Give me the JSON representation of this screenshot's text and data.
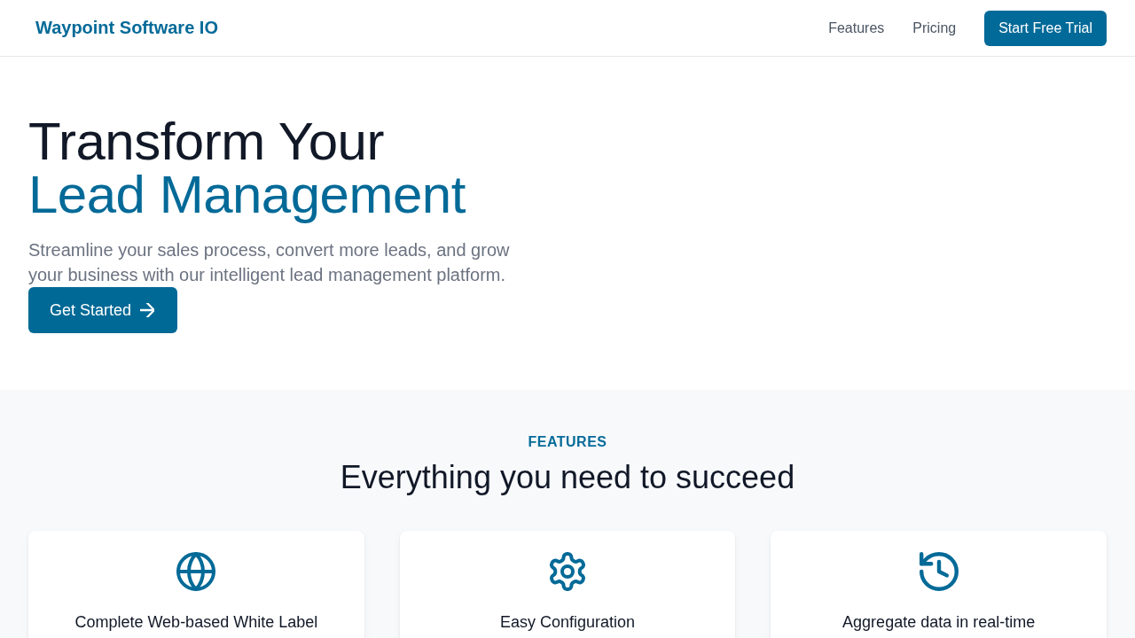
{
  "navbar": {
    "logo": "Waypoint Software IO",
    "links": [
      {
        "label": "Features"
      },
      {
        "label": "Pricing"
      }
    ],
    "cta": "Start Free Trial"
  },
  "hero": {
    "title_line_1": "Transform Your",
    "title_line_2": "Lead Management",
    "subtitle": "Streamline your sales process, convert more leads, and grow your business with our intelligent lead management platform.",
    "button": "Get Started"
  },
  "features": {
    "eyebrow": "FEATURES",
    "heading": "Everything you need to succeed",
    "cards": [
      {
        "title": "Complete Web-based White Label"
      },
      {
        "title": "Easy Configuration"
      },
      {
        "title": "Aggregate data in real-time"
      }
    ]
  }
}
